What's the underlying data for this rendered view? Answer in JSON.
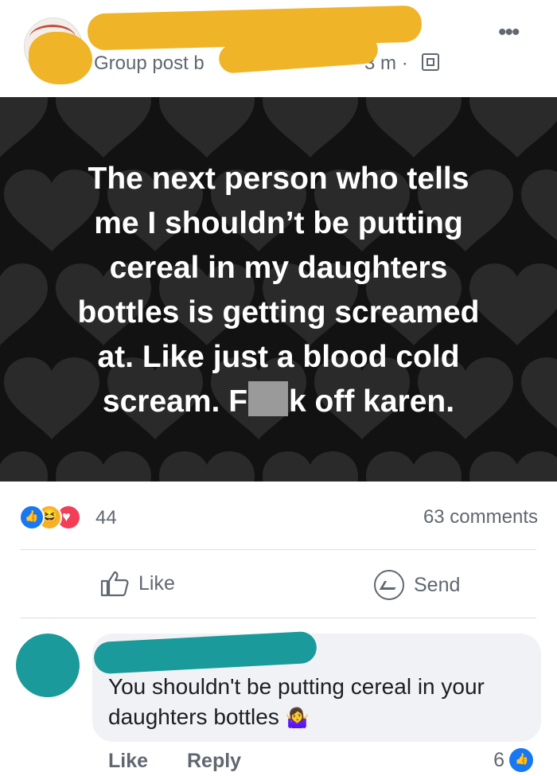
{
  "header": {
    "meta_prefix": "Group post b",
    "time": "3 m",
    "time_sep": "·",
    "privacy_icon": "group-icon",
    "more_icon": "more-dots-icon"
  },
  "post": {
    "lines": [
      "The next person who tells",
      "me I shouldn’t be putting",
      "cereal in my daughters",
      "bottles is getting screamed",
      "at. Like just a blood cold"
    ],
    "last_line_start": "scream. F",
    "last_line_end": "k off karen."
  },
  "stats": {
    "reaction_count": "44",
    "comments": "63 comments",
    "reaction_icons": [
      "like-icon",
      "haha-icon",
      "love-icon"
    ]
  },
  "actions": {
    "like_label": "Like",
    "send_label": "Send"
  },
  "comment": {
    "text": "You shouldn't be putting cereal in your daughters bottles",
    "emoji": "🤷‍♀️",
    "like_label": "Like",
    "reply_label": "Reply",
    "like_count": "6"
  },
  "colors": {
    "redaction_yellow": "#f0b429",
    "redaction_teal": "#1a9a9a",
    "facebook_blue": "#1877f2"
  }
}
